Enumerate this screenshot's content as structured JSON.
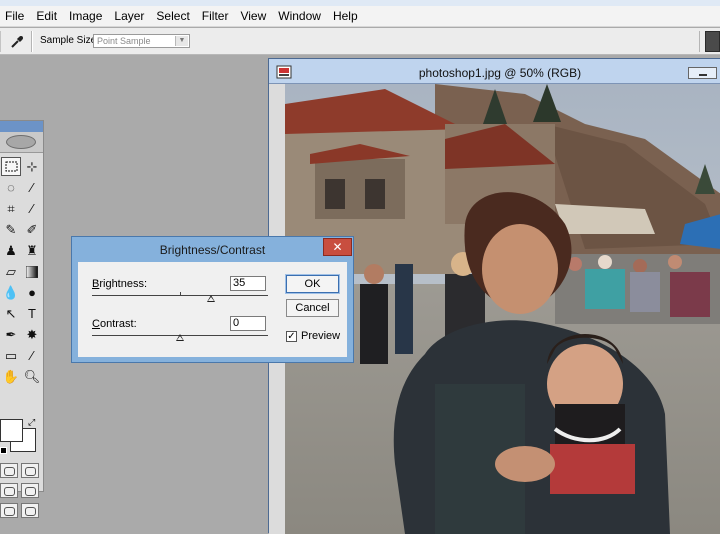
{
  "menu": {
    "items": [
      "File",
      "Edit",
      "Image",
      "Layer",
      "Select",
      "Filter",
      "View",
      "Window",
      "Help"
    ]
  },
  "options_bar": {
    "tool_icon": "eyedropper-icon",
    "sample_size_label": "Sample Size:",
    "sample_size_value": "Point Sample"
  },
  "document": {
    "title": "photoshop1.jpg @ 50% (RGB)",
    "zoom_percent": 50
  },
  "toolbox": {
    "icons": [
      "marquee-icon",
      "move-icon",
      "lasso-icon",
      "magic-wand-icon",
      "crop-icon",
      "slice-icon",
      "healing-brush-icon",
      "brush-icon",
      "clone-stamp-icon",
      "history-brush-icon",
      "eraser-icon",
      "gradient-icon",
      "blur-icon",
      "dodge-icon",
      "path-selection-icon",
      "type-icon",
      "pen-icon",
      "custom-shape-icon",
      "notes-icon",
      "eyedropper-icon",
      "hand-icon",
      "zoom-icon"
    ]
  },
  "dialog": {
    "title": "Brightness/Contrast",
    "brightness_label": "Brightness:",
    "brightness_mnemonic": "B",
    "brightness_rest": "rightness:",
    "brightness_value": "35",
    "contrast_label": "Contrast:",
    "contrast_mnemonic": "C",
    "contrast_rest": "ontrast:",
    "contrast_value": "0",
    "ok_label": "OK",
    "cancel_label": "Cancel",
    "preview_label": "Preview",
    "preview_checked": true,
    "close_glyph": "✕"
  },
  "colors": {
    "dialog_frame": "#85b1dc",
    "close_button": "#c84e3f",
    "doc_title_bar": "#bfd4ee"
  }
}
